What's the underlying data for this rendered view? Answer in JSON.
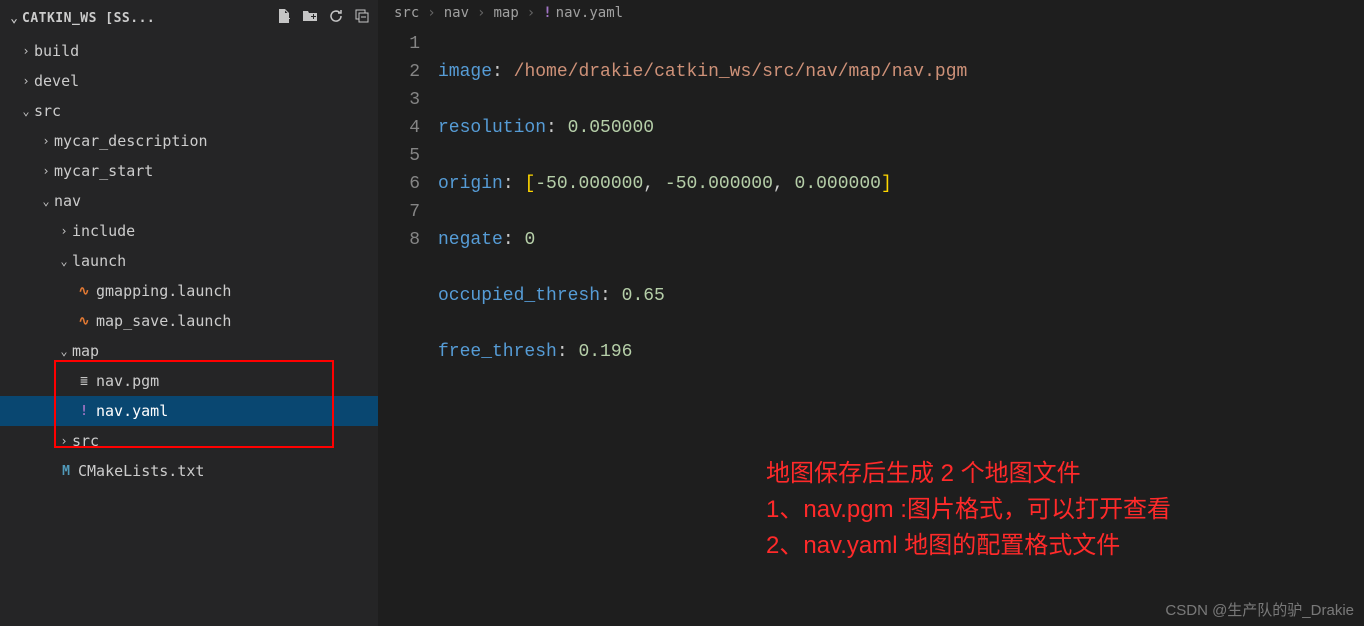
{
  "explorer": {
    "title": "CATKIN_WS [SS...",
    "actions": {
      "new_file": "new-file-icon",
      "new_folder": "new-folder-icon",
      "refresh": "refresh-icon",
      "collapse": "collapse-all-icon"
    }
  },
  "tree": {
    "build": "build",
    "devel": "devel",
    "src": "src",
    "mycar_description": "mycar_description",
    "mycar_start": "mycar_start",
    "nav": "nav",
    "include": "include",
    "launch": "launch",
    "gmapping": "gmapping.launch",
    "map_save": "map_save.launch",
    "map": "map",
    "nav_pgm": "nav.pgm",
    "nav_yaml": "nav.yaml",
    "src2": "src",
    "cmakelists": "CMakeLists.txt"
  },
  "breadcrumbs": {
    "p0": "src",
    "p1": "nav",
    "p2": "map",
    "p3": "nav.yaml"
  },
  "code": {
    "lines": [
      "1",
      "2",
      "3",
      "4",
      "5",
      "6",
      "7",
      "8"
    ],
    "k_image": "image",
    "v_image": "/home/drakie/catkin_ws/src/nav/map/nav.pgm",
    "k_resolution": "resolution",
    "v_resolution": "0.050000",
    "k_origin": "origin",
    "v_o0": "-50.000000",
    "v_o1": "-50.000000",
    "v_o2": "0.000000",
    "k_negate": "negate",
    "v_negate": "0",
    "k_occ": "occupied_thresh",
    "v_occ": "0.65",
    "k_free": "free_thresh",
    "v_free": "0.196"
  },
  "annotation": {
    "l1": "地图保存后生成 2 个地图文件",
    "l2": "1、nav.pgm :图片格式，可以打开查看",
    "l3": "2、nav.yaml 地图的配置格式文件"
  },
  "watermark": "CSDN @生产队的驴_Drakie"
}
